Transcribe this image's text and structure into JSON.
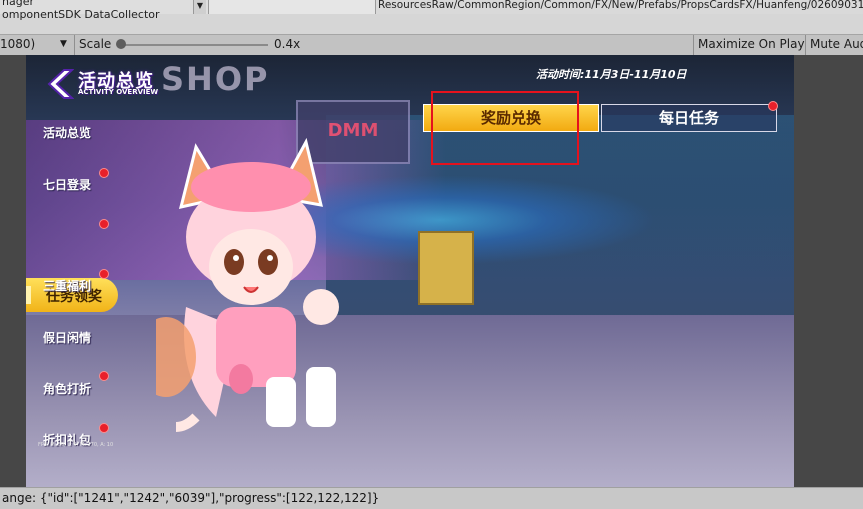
{
  "editor": {
    "top_left_label": "nager",
    "top_left_label2": "omponentSDK DataCollector",
    "top_path": "ResourcesRaw/CommonRegion/Common/FX/New/Prefabs/PropsCardsFX/Huanfeng/02609031_Huanfeng",
    "resolution_suffix": "1080)",
    "scale_label": "Scale",
    "scale_value": "0.4x",
    "scale_fraction": 0.04,
    "maximize_label": "Maximize On Play",
    "mute_label": "Mute Aud",
    "status_text": "ange: {\"id\":[\"1241\",\"1242\",\"6039\"],\"progress\":[122,122,122]}"
  },
  "game": {
    "title": "活动总览",
    "subtitle": "ACTIVITY OVERVIEW",
    "shop_sign": "SHOP",
    "dmm_sign": "DMM",
    "activity_time": "活动时间:11月3日-11月10日",
    "tabs": [
      {
        "label": "奖励兑换",
        "active": true
      },
      {
        "label": "每日任务",
        "active": false
      }
    ],
    "sidebar": [
      {
        "label": "活动总览",
        "red_dot": false
      },
      {
        "label": "七日登录",
        "red_dot": true
      },
      {
        "label": "任务领奖",
        "red_dot": true,
        "active": true
      },
      {
        "label": "三重福利",
        "red_dot": true
      },
      {
        "label": "假日闲情",
        "red_dot": false
      },
      {
        "label": "角色打折",
        "red_dot": true
      },
      {
        "label": "折扣礼包",
        "red_dot": true
      }
    ],
    "fps_text": "FPS: M: 59, L: 9, M: 170, A: 10",
    "colors": {
      "accent_gold": "#f2aa11",
      "red_dot": "#e8202a",
      "highlight_box": "#e5121d"
    }
  }
}
